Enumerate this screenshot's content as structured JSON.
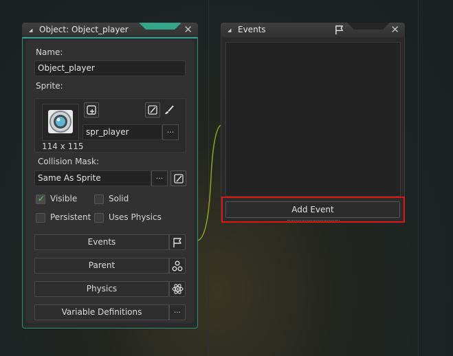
{
  "object_window": {
    "title": "Object: Object_player",
    "close_glyph": "✕",
    "name_label": "Name:",
    "name_value": "Object_player",
    "sprite_label": "Sprite:",
    "sprite_name": "spr_player",
    "sprite_size": "114 x 115",
    "collision_label": "Collision Mask:",
    "collision_value": "Same As Sprite",
    "checkboxes": {
      "visible": {
        "label": "Visible",
        "checked": true
      },
      "solid": {
        "label": "Solid",
        "checked": false
      },
      "persistent": {
        "label": "Persistent",
        "checked": false
      },
      "uses_physics": {
        "label": "Uses Physics",
        "checked": false
      }
    },
    "buttons": {
      "events": "Events",
      "parent": "Parent",
      "physics": "Physics",
      "variable_definitions": "Variable Definitions"
    },
    "more_glyph": "···"
  },
  "events_window": {
    "title": "Events",
    "close_glyph": "✕",
    "add_event_label": "Add Event"
  },
  "colors": {
    "accent": "#34a58a",
    "highlight": "#e01616",
    "check": "#5ed45e",
    "wire": "#8aa61e"
  },
  "icons": [
    "collapse-triangle-icon",
    "close-icon",
    "add-sprite-icon",
    "edit-image-icon",
    "brush-icon",
    "flag-icon",
    "hierarchy-icon",
    "atom-icon",
    "more-icon",
    "checkmark-icon"
  ]
}
